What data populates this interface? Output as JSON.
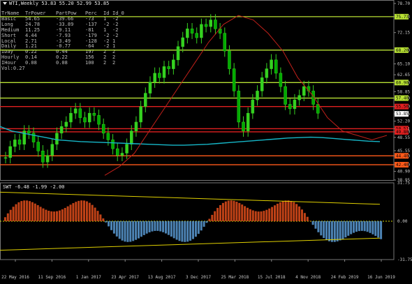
{
  "chart_data": [
    {
      "type": "line",
      "title": "WTI,Weekly 53.83 55.20 52.99 53.85",
      "y_ticks": [
        "78.70",
        "75.73",
        "72.15",
        "68.20",
        "65.10",
        "62.65",
        "60.90",
        "58.85",
        "57.40",
        "55.50",
        "53.85",
        "52.20",
        "50.51",
        "49.80",
        "48.55",
        "45.55",
        "44.40",
        "42.40",
        "40.90",
        "38.95"
      ],
      "x_ticks": [
        "22 May 2016",
        "11 Sep 2016",
        "1 Jan 2017",
        "23 Apr 2017",
        "13 Aug 2017",
        "3 Dec 2017",
        "25 Mar 2018",
        "15 Jul 2018",
        "4 Nov 2018",
        "24 Feb 2019",
        "16 Jun 2019"
      ],
      "price_tags": [
        {
          "label": "75.73",
          "color": "#b7e034"
        },
        {
          "label": "68.20",
          "color": "#b7e034"
        },
        {
          "label": "60.90",
          "color": "#b7e034"
        },
        {
          "label": "57.40",
          "color": "#b7e034"
        },
        {
          "label": "55.50",
          "color": "#e02020"
        },
        {
          "label": "53.85",
          "color": "#ffffff"
        },
        {
          "label": "50.51",
          "color": "#e02020"
        },
        {
          "label": "49.80",
          "color": "#e02020"
        },
        {
          "label": "44.40",
          "color": "#ff5a1a"
        },
        {
          "label": "42.40",
          "color": "#ff5a1a"
        }
      ],
      "levels": [
        {
          "value": 75.73,
          "color": "#b7e034"
        },
        {
          "value": 68.2,
          "color": "#b7e034"
        },
        {
          "value": 60.9,
          "color": "#b7e034"
        },
        {
          "value": 57.4,
          "color": "#b7e034"
        },
        {
          "value": 55.5,
          "color": "#e02020"
        },
        {
          "value": 50.51,
          "color": "#e02020"
        },
        {
          "value": 49.8,
          "color": "#e02020"
        },
        {
          "value": 44.4,
          "color": "#ff5a1a"
        },
        {
          "value": 42.4,
          "color": "#ff5a1a"
        }
      ],
      "ylim": [
        38.95,
        78.7
      ],
      "series": [
        {
          "values": [
            44,
            46.5,
            48,
            47,
            50,
            49.5,
            47.5,
            45.5,
            43,
            44.5,
            47,
            49.5,
            51,
            52,
            54,
            55,
            53,
            52,
            54,
            53.5,
            51.5,
            49.5,
            48,
            46,
            44.5,
            45,
            47,
            50,
            52,
            55.5,
            58.5,
            61,
            63,
            62,
            64.5,
            64,
            66,
            69,
            71,
            73,
            72,
            71,
            74,
            73.5,
            75,
            73,
            72,
            68,
            64,
            59,
            52,
            50,
            54,
            57,
            59,
            62,
            64,
            66,
            63,
            60,
            56,
            55,
            57,
            58,
            60,
            59,
            56,
            54
          ]
        },
        {
          "values": [
            51,
            50,
            49.5,
            49,
            48.5,
            48,
            47.8,
            47.6,
            47.5,
            47.4,
            47.3,
            47.2,
            47.1,
            47,
            46.9,
            46.8,
            46.8,
            46.9,
            47,
            47.2,
            47.4,
            47.6,
            47.8,
            48,
            48.2,
            48.4,
            48.5,
            48.6,
            48.5,
            48.3,
            48.1,
            47.9,
            47.7,
            47.6
          ]
        },
        {
          "values": [
            40,
            42,
            45,
            50,
            55,
            60,
            65,
            70,
            74,
            76,
            75,
            72,
            68,
            62,
            58,
            53,
            50,
            49,
            48,
            49
          ]
        }
      ]
    },
    {
      "type": "bar",
      "title": "SWT -6.48 -1.99 -2.00",
      "y_ticks": [
        "31.75",
        "0.00",
        "-31.75"
      ],
      "ylim": [
        -31.75,
        31.75
      ]
    }
  ],
  "table": {
    "header": [
      "TrName",
      "TrPower",
      "PartPow",
      "Perc",
      "Id",
      "Id_0"
    ],
    "rows": [
      [
        "Basic",
        "54.65",
        "-39.66",
        "-73",
        "1",
        "-2"
      ],
      [
        "Long",
        "24.78",
        "-33.89",
        "-137",
        "-2",
        "-2"
      ],
      [
        "Medium",
        "11.25",
        "-9.11",
        "-81",
        "1",
        "-2"
      ],
      [
        "Short",
        "4.44",
        "-7.93",
        "-179",
        "-2",
        "-2"
      ],
      [
        "Local",
        "2.71",
        "-3.49",
        "-128",
        "-2",
        "1"
      ],
      [
        "Daily",
        "1.21",
        "-0.77",
        "-64",
        "-2",
        "1"
      ],
      [
        "IDay",
        "0.22",
        "0.44",
        "197",
        "2",
        "2"
      ],
      [
        "Hourly",
        "0.14",
        "0.22",
        "156",
        "2",
        "2"
      ],
      [
        "IHour",
        "0.08",
        "0.08",
        "100",
        "2",
        "2"
      ]
    ],
    "footer": "Vol:0.27"
  },
  "colors": {
    "bull": "#35d120",
    "bear": "#35d120",
    "ma_red": "#c0201a",
    "ma_cyan": "#16b7c8",
    "level": "#b7e034"
  }
}
